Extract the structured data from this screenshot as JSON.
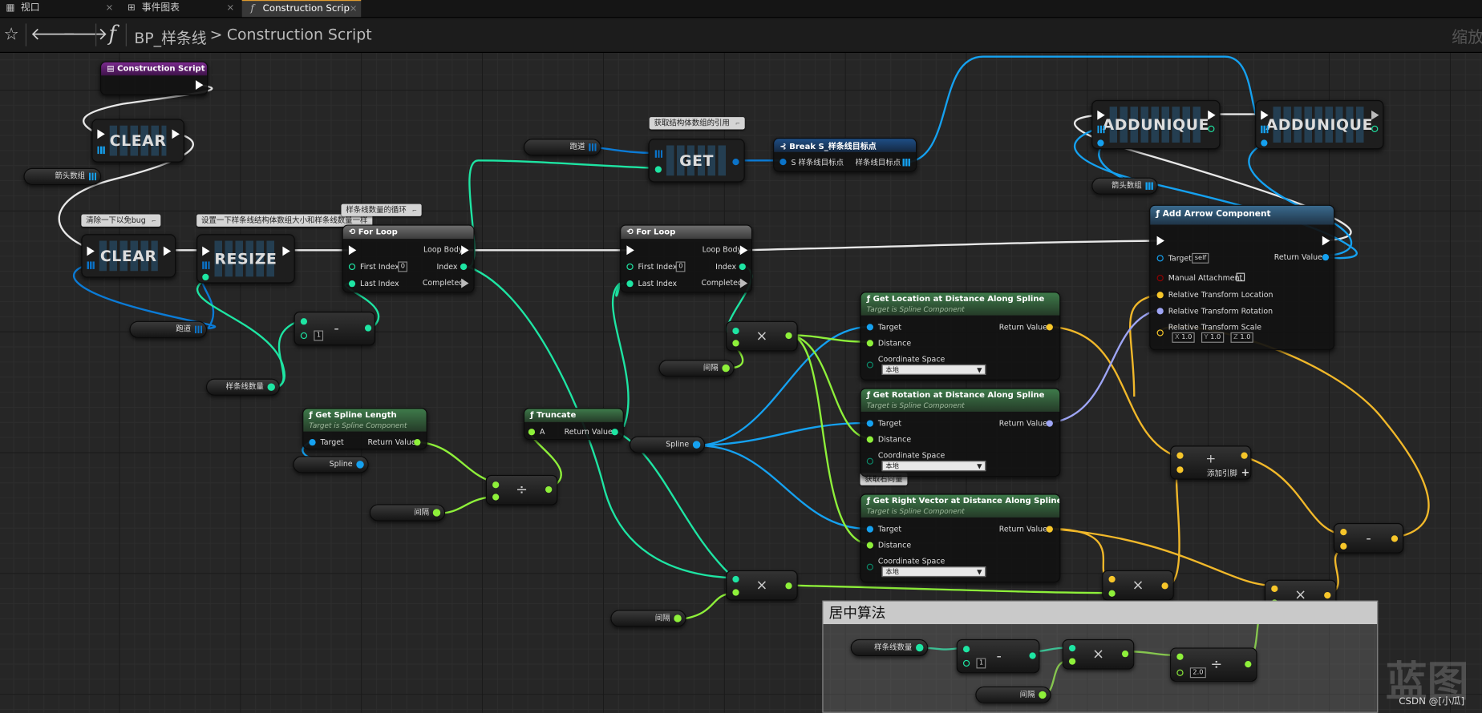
{
  "tabs": [
    {
      "label": "视口",
      "icon": "viewport-icon"
    },
    {
      "label": "事件图表",
      "icon": "event-graph-icon"
    },
    {
      "label": "Construction Scrip",
      "icon": "function-icon"
    }
  ],
  "toolbar": {
    "blueprint": "BP_样条线",
    "separator": ">",
    "function": "Construction Script",
    "zoom": "缩放-"
  },
  "nodes": {
    "construction_script": "Construction Script",
    "clear1": "CLEAR",
    "clear2": "CLEAR",
    "resize": "RESIZE",
    "get": "GET",
    "addunique1": "ADDUNIQUE",
    "addunique2": "ADDUNIQUE",
    "break": {
      "title": "Break S_样条线目标点",
      "pin_in": "S 样条线目标点",
      "pin_out": "样条线目标点"
    },
    "forloop1": {
      "title": "For Loop",
      "first": "First Index",
      "first_val": "0",
      "last": "Last Index",
      "body": "Loop Body",
      "index": "Index",
      "completed": "Completed"
    },
    "forloop2": {
      "title": "For Loop",
      "first": "First Index",
      "first_val": "0",
      "last": "Last Index",
      "body": "Loop Body",
      "index": "Index",
      "completed": "Completed"
    },
    "get_spline_length": {
      "title": "Get Spline Length",
      "sub": "Target is Spline Component",
      "target": "Target",
      "ret": "Return Value"
    },
    "truncate": {
      "title": "Truncate",
      "a": "A",
      "ret": "Return Value"
    },
    "get_location": {
      "title": "Get Location at Distance Along Spline",
      "sub": "Target is Spline Component",
      "target": "Target",
      "distance": "Distance",
      "space": "Coordinate Space",
      "space_val": "本地",
      "ret": "Return Value"
    },
    "get_rotation": {
      "title": "Get Rotation at Distance Along Spline",
      "sub": "Target is Spline Component",
      "target": "Target",
      "distance": "Distance",
      "space": "Coordinate Space",
      "space_val": "本地",
      "ret": "Return Value"
    },
    "get_right": {
      "title": "Get Right Vector at Distance Along Spline",
      "sub": "Target is Spline Component",
      "target": "Target",
      "distance": "Distance",
      "space": "Coordinate Space",
      "space_val": "本地",
      "ret": "Return Value"
    },
    "add_arrow": {
      "title": "Add Arrow Component",
      "target": "Target",
      "self": "self",
      "manual": "Manual Attachment",
      "loc": "Relative Transform Location",
      "rot": "Relative Transform Rotation",
      "scale": "Relative Transform Scale",
      "ret": "Return Value",
      "x": "X",
      "xv": "1.0",
      "y": "Y",
      "yv": "1.0",
      "z": "Z",
      "zv": "1.0"
    },
    "add_pin": "添加引脚",
    "minus_one": "1",
    "center_one": "1",
    "center_div": "2.0"
  },
  "variables": {
    "arrow_array1": "箭头数组",
    "arrow_array2": "箭头数组",
    "track1": "跑道",
    "track2": "跑道",
    "spline_count1": "样条线数量",
    "spline_count2": "样条线数量",
    "spline1": "Spline",
    "spline2": "Spline",
    "interval1": "间隔",
    "interval2": "间隔",
    "interval3": "间隔",
    "interval4": "间隔"
  },
  "comments": {
    "clear_bug": "清除一下以免bug",
    "resize_note": "设置一下样条线结构体数组大小和样条线数量一样",
    "loop_note": "样条线数量的循环",
    "get_ref": "获取结构体数组的引用",
    "right_vec": "获取右向量",
    "center_title": "居中算法"
  },
  "watermark": "蓝图",
  "credit": "CSDN @[小瓜]",
  "colors": {
    "exec": "#ffffff",
    "int": "#1ee5a3",
    "float": "#8ef03a",
    "object": "#1ba3f2",
    "struct": "#0b73c8",
    "vector": "#f7c62a",
    "rotator": "#9ea5f5",
    "bool": "#920101"
  }
}
